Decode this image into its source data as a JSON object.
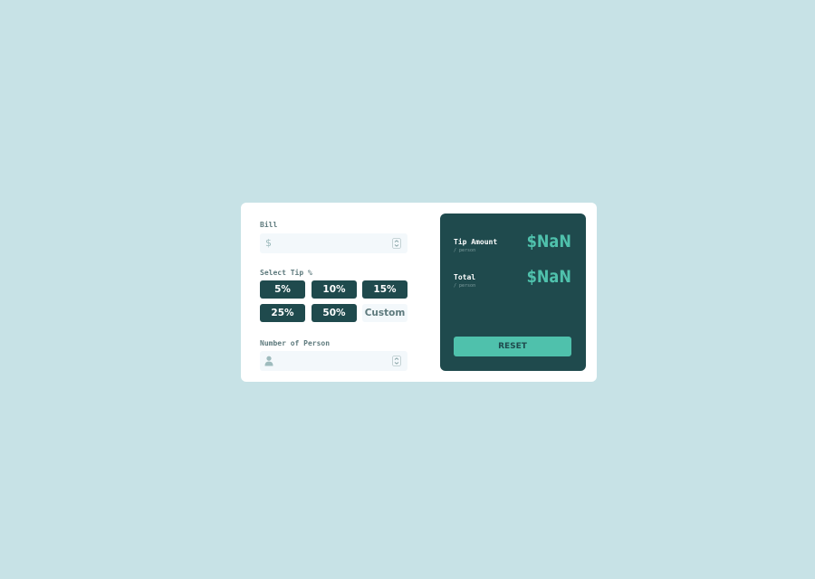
{
  "colors": {
    "page_background": "#c7e2e6",
    "card_background": "#ffffff",
    "primary_dark": "#1f4a4d",
    "accent": "#4fc1ac",
    "input_background": "#f3f8fb",
    "label_text": "#5e7a7d"
  },
  "form": {
    "bill": {
      "label": "Bill",
      "prefix": "$",
      "prefix_icon": "dollar-icon",
      "value": "",
      "placeholder": ""
    },
    "tip": {
      "label": "Select Tip %",
      "options": [
        {
          "label": "5%"
        },
        {
          "label": "10%"
        },
        {
          "label": "15%"
        },
        {
          "label": "25%"
        },
        {
          "label": "50%"
        },
        {
          "label": "Custom"
        }
      ]
    },
    "people": {
      "label": "Number of Person",
      "prefix_icon": "person-icon",
      "value": "",
      "placeholder": ""
    }
  },
  "results": {
    "tip_amount": {
      "label": "Tip Amount",
      "sub": "/ person",
      "value": "$NaN"
    },
    "total": {
      "label": "Total",
      "sub": "/ person",
      "value": "$NaN"
    },
    "reset_label": "RESET"
  }
}
